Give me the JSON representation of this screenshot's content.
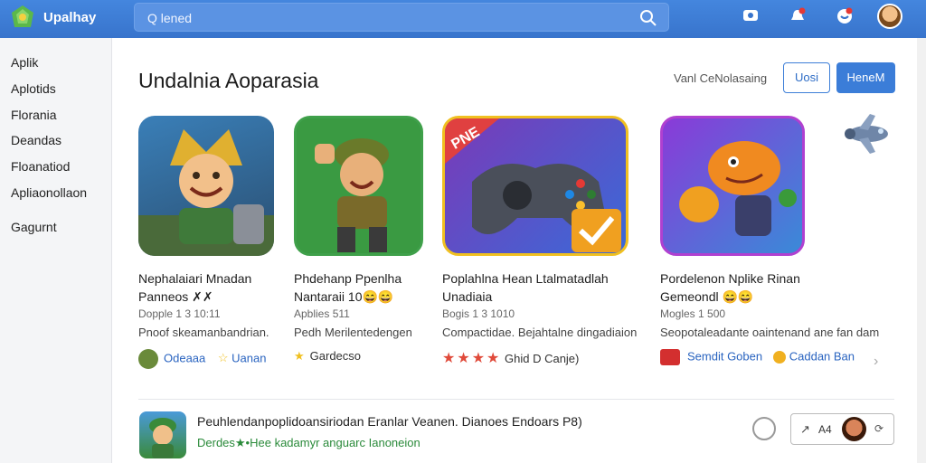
{
  "header": {
    "brand": "Upalhay",
    "search_text": "Q lened"
  },
  "sidebar": {
    "items": [
      {
        "label": "Aplik"
      },
      {
        "label": "Aplotids"
      },
      {
        "label": "Florania"
      },
      {
        "label": "Deandas"
      },
      {
        "label": "Floanatiod"
      },
      {
        "label": "Apliaonollaon"
      },
      {
        "label": "Gagurnt"
      }
    ]
  },
  "main": {
    "title": "Undalnia Aoparasia",
    "sort_label": "Vanl CeNolasaing",
    "btn_outline": "Uosi",
    "btn_filled": "HeneM"
  },
  "cards": [
    {
      "title_line1": "Nephalaiari Mnadan",
      "title_line2": "Panneos ✗✗",
      "meta": "Dopple 1 3 10:11",
      "desc": "Pnoof skeamanbandrian.",
      "foot_a": "Odeaaa",
      "foot_b": "Uanan"
    },
    {
      "title_line1": "Phdehanp Ppenlha",
      "title_line2": "Nantaraii 10😄😄",
      "meta": "Apblies 511",
      "desc": "Pedh Merilentedengen",
      "foot_a": "Gardecso",
      "foot_b": ""
    },
    {
      "title_line1": "Poplahlna Hean Ltalmatadlah",
      "title_line2": "Unadiaia",
      "meta": "Bogis 1 3 1010",
      "desc": "Compactidae. Bejahtalne dingadiaion",
      "foot_a": "Ghid D Canje)",
      "foot_b": ""
    },
    {
      "title_line1": "Pordelenon Nplike Rinan",
      "title_line2": "Gemeondl 😄😄",
      "meta": "Mogles 1 500",
      "desc": "Seopotaleadante oaintenand ane fan dam",
      "foot_a": "Semdit Goben",
      "foot_b": "Caddan Ban"
    }
  ],
  "row": {
    "title": "Peuhlendanpoplidoansiriodan Eranlar Veanen. Dianoes Endoars P8)",
    "subtitle": "Derdes★•Hee kadamyr anguarc Ianoneion",
    "btn_label": "A4"
  },
  "colors": {
    "header_bg": "#3a7bd5",
    "accent": "#3b7dd8",
    "sidebar_bg": "#f4f5f7",
    "star": "#e04a3a"
  }
}
